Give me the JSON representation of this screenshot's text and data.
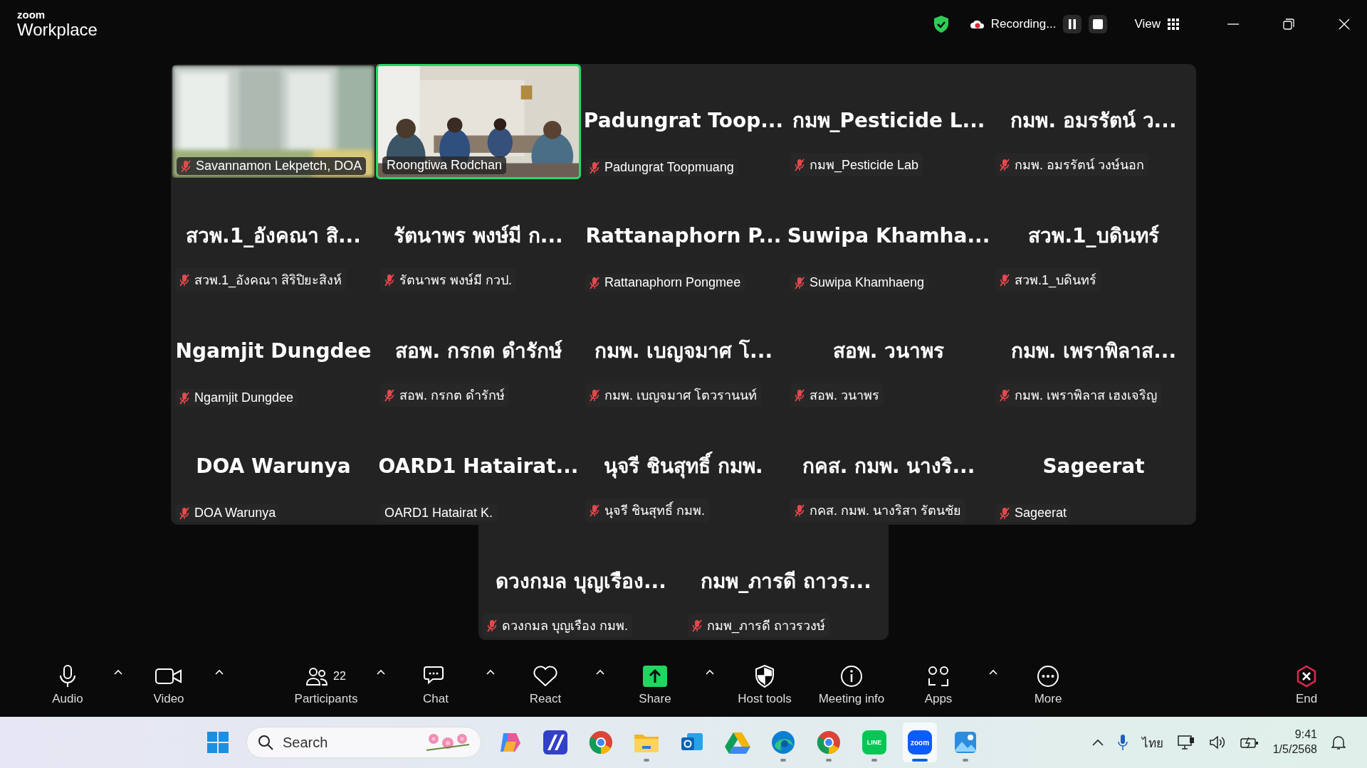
{
  "window": {
    "brand_small": "zoom",
    "brand": "Workplace",
    "recording": "Recording...",
    "view": "View"
  },
  "grid": [
    {
      "kind": "video",
      "label": "Savannamon Lekpetch, DOA",
      "muted": true,
      "speaking": false,
      "blurred": true
    },
    {
      "kind": "video",
      "label": "Roongtiwa Rodchan",
      "muted": false,
      "speaking": true,
      "blurred": false
    },
    {
      "kind": "name",
      "title": "Padungrat  Toop...",
      "label": "Padungrat Toopmuang",
      "muted": true,
      "speaking": false
    },
    {
      "kind": "name",
      "title": "กมพ_Pesticide L...",
      "label": "กมพ_Pesticide Lab",
      "muted": true,
      "speaking": false
    },
    {
      "kind": "name",
      "title": "กมพ. อมรรัตน์ ว...",
      "label": "กมพ. อมรรัตน์ วงษ์นอก",
      "muted": true,
      "speaking": false
    },
    {
      "kind": "name",
      "title": "สวพ.1_อังคณา สิ...",
      "label": "สวพ.1_อังคณา สิริปิยะสิงห์",
      "muted": true,
      "speaking": false
    },
    {
      "kind": "name",
      "title": "รัตนาพร พงษ์มี ก...",
      "label": "รัตนาพร พงษ์มี กวป.",
      "muted": true,
      "speaking": false
    },
    {
      "kind": "name",
      "title": "Rattanaphorn  P...",
      "label": "Rattanaphorn Pongmee",
      "muted": true,
      "speaking": false
    },
    {
      "kind": "name",
      "title": "Suwipa  Khamha...",
      "label": "Suwipa Khamhaeng",
      "muted": true,
      "speaking": false
    },
    {
      "kind": "name",
      "title": "สวพ.1_บดินทร์",
      "label": "สวพ.1_บดินทร์",
      "muted": true,
      "speaking": false
    },
    {
      "kind": "name",
      "title": "Ngamjit Dungdee",
      "label": "Ngamjit Dungdee",
      "muted": true,
      "speaking": false
    },
    {
      "kind": "name",
      "title": "สอพ. กรกต ดำรักษ์",
      "label": "สอพ. กรกต ดำรักษ์",
      "muted": true,
      "speaking": false
    },
    {
      "kind": "name",
      "title": "กมพ. เบญจมาศ โ...",
      "label": "กมพ. เบญจมาศ โตวรานนท์",
      "muted": true,
      "speaking": false
    },
    {
      "kind": "name",
      "title": "สอพ. วนาพร",
      "label": "สอพ. วนาพร",
      "muted": true,
      "speaking": false
    },
    {
      "kind": "name",
      "title": "กมพ. เพราพิลาส...",
      "label": "กมพ. เพราพิลาส เฮงเจริญ",
      "muted": true,
      "speaking": false
    },
    {
      "kind": "name",
      "title": "DOA Warunya",
      "label": "DOA Warunya",
      "muted": true,
      "speaking": false
    },
    {
      "kind": "name",
      "title": "OARD1  Hatairat...",
      "label": "OARD1 Hatairat K.",
      "muted": false,
      "speaking": false
    },
    {
      "kind": "name",
      "title": "นุจรี ชินสุทธิ์ กมพ.",
      "label": "นุจรี ชินสุทธิ์ กมพ.",
      "muted": true,
      "speaking": false
    },
    {
      "kind": "name",
      "title": "กคส. กมพ. นางริ...",
      "label": "กคส. กมพ. นางริสา รัตนชัย",
      "muted": true,
      "speaking": false
    },
    {
      "kind": "name",
      "title": "Sageerat",
      "label": "Sageerat",
      "muted": true,
      "speaking": false
    }
  ],
  "overflow": [
    {
      "kind": "name",
      "title": "ดวงกมล บุญเรือง...",
      "label": "ดวงกมล บุญเรือง กมพ.",
      "muted": true,
      "speaking": false
    },
    {
      "kind": "name",
      "title": "กมพ_ภารดี ถาวร...",
      "label": "กมพ_ภารดี ถาวรวงษ์",
      "muted": true,
      "speaking": false
    }
  ],
  "toolbar": {
    "left": [
      {
        "kind": "audio",
        "label": "Audio",
        "caret": true
      },
      {
        "kind": "video",
        "label": "Video",
        "caret": true
      }
    ],
    "center": [
      {
        "kind": "participants",
        "label": "Participants",
        "count": "22",
        "caret": true
      },
      {
        "kind": "chat",
        "label": "Chat",
        "caret": true
      },
      {
        "kind": "react",
        "label": "React",
        "caret": true
      },
      {
        "kind": "share",
        "label": "Share",
        "caret": true
      },
      {
        "kind": "host",
        "label": "Host tools"
      },
      {
        "kind": "info",
        "label": "Meeting info"
      },
      {
        "kind": "apps",
        "label": "Apps",
        "caret": true
      },
      {
        "kind": "more",
        "label": "More"
      }
    ],
    "right": [
      {
        "kind": "end",
        "label": "End"
      }
    ]
  },
  "taskbar": {
    "search": {
      "placeholder": "Search"
    },
    "apps": [
      {
        "kind": "copilot",
        "running": false,
        "selected": false
      },
      {
        "kind": "m365",
        "running": false,
        "selected": false
      },
      {
        "kind": "chrome",
        "running": false,
        "selected": false
      },
      {
        "kind": "files",
        "running": true,
        "selected": false
      },
      {
        "kind": "outlook",
        "running": false,
        "selected": false
      },
      {
        "kind": "drive",
        "running": false,
        "selected": false
      },
      {
        "kind": "edge",
        "running": true,
        "selected": false
      },
      {
        "kind": "chrome",
        "running": true,
        "selected": false
      },
      {
        "kind": "line",
        "label": "LINE",
        "running": true,
        "selected": false
      },
      {
        "kind": "zoom",
        "label": "zoom",
        "running": true,
        "selected": true
      },
      {
        "kind": "photos",
        "running": true,
        "selected": false
      }
    ],
    "language": "ไทย",
    "time": "9:41",
    "date": "1/5/2568"
  }
}
